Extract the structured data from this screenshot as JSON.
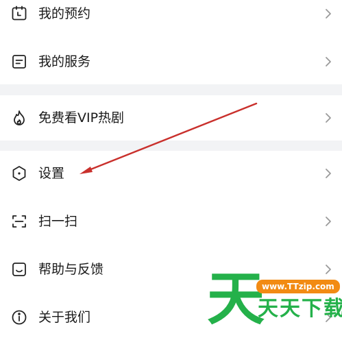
{
  "menu": {
    "group1": [
      {
        "label": "我的预约",
        "icon": "calendar-icon"
      },
      {
        "label": "我的服务",
        "icon": "document-icon"
      }
    ],
    "group2": [
      {
        "label": "免费看VIP热剧",
        "icon": "flame-icon"
      }
    ],
    "group3": [
      {
        "label": "设置",
        "icon": "hexagon-settings-icon"
      },
      {
        "label": "扫一扫",
        "icon": "scan-icon"
      },
      {
        "label": "帮助与反馈",
        "icon": "message-icon"
      },
      {
        "label": "关于我们",
        "icon": "info-icon"
      }
    ]
  },
  "annotation": {
    "arrow_color": "#c9302c",
    "points_to": "设置"
  },
  "watermark": {
    "big_char": "天",
    "url": "www.TTzip.com",
    "name": "天天下载",
    "green": "#24b14a",
    "orange": "#f28b13"
  }
}
